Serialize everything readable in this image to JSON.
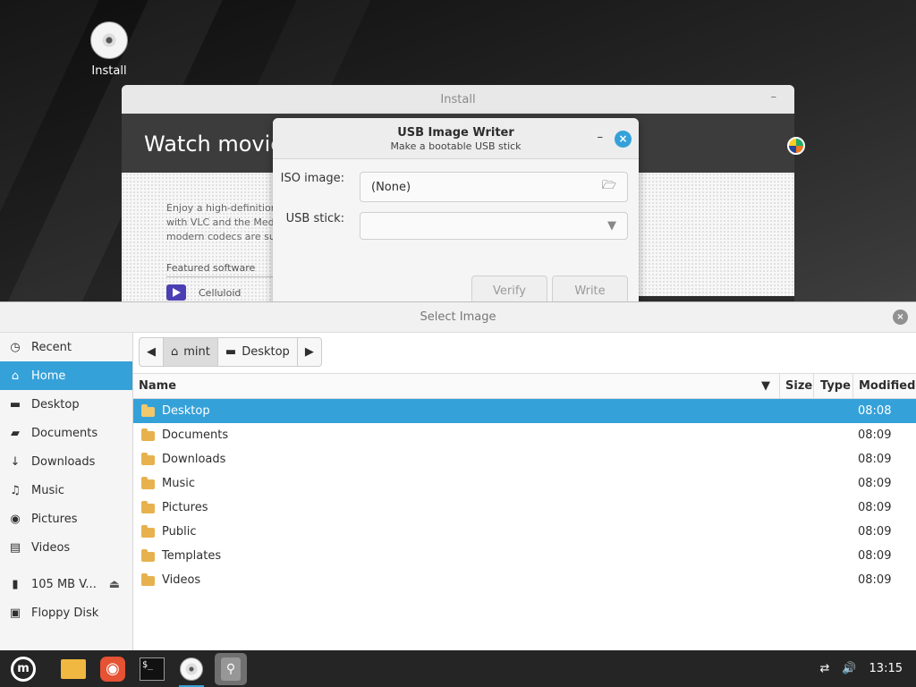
{
  "desktop": {
    "icon_label": "Install"
  },
  "install": {
    "title": "Install",
    "hero": "Watch movies",
    "description_1": "Enjoy a high-definition",
    "description_2": "with VLC and the Med",
    "description_3": "modern codecs are sup",
    "featured": "Featured software",
    "app": "Celluloid"
  },
  "usb_writer": {
    "title": "USB Image Writer",
    "subtitle": "Make a bootable USB stick",
    "iso_label": "ISO image:",
    "iso_value": "(None)",
    "usb_label": "USB stick:",
    "verify": "Verify",
    "write": "Write"
  },
  "select_image": {
    "title": "Select Image",
    "sidebar": [
      {
        "label": "Recent",
        "icon": "clock-icon"
      },
      {
        "label": "Home",
        "icon": "home-icon"
      },
      {
        "label": "Desktop",
        "icon": "desktop-icon"
      },
      {
        "label": "Documents",
        "icon": "document-icon"
      },
      {
        "label": "Downloads",
        "icon": "download-icon"
      },
      {
        "label": "Music",
        "icon": "music-icon"
      },
      {
        "label": "Pictures",
        "icon": "camera-icon"
      },
      {
        "label": "Videos",
        "icon": "video-icon"
      },
      {
        "label": "105 MB V...",
        "icon": "drive-icon"
      },
      {
        "label": "Floppy Disk",
        "icon": "floppy-icon"
      }
    ],
    "path": [
      "mint",
      "Desktop"
    ],
    "columns": [
      "Name",
      "Size",
      "Type",
      "Modified"
    ],
    "files": [
      {
        "name": "Desktop",
        "modified": "08:08"
      },
      {
        "name": "Documents",
        "modified": "08:09"
      },
      {
        "name": "Downloads",
        "modified": "08:09"
      },
      {
        "name": "Music",
        "modified": "08:09"
      },
      {
        "name": "Pictures",
        "modified": "08:09"
      },
      {
        "name": "Public",
        "modified": "08:09"
      },
      {
        "name": "Templates",
        "modified": "08:09"
      },
      {
        "name": "Videos",
        "modified": "08:09"
      }
    ]
  },
  "taskbar": {
    "clock": "13:15"
  },
  "colors": {
    "accent": "#35a1d9",
    "folder": "#e7b24d",
    "taskbar": "#252525"
  }
}
